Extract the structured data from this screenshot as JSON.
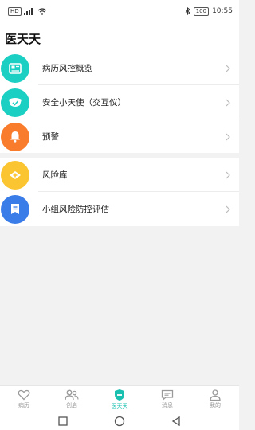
{
  "status_bar": {
    "sim_label": "HD",
    "signal": "4G",
    "battery": "100",
    "time": "10:55"
  },
  "header": {
    "title": "医天天"
  },
  "menu_group_1": [
    {
      "label": "病历风控概览",
      "icon": "medical-record-icon",
      "color": "#1ccfc3"
    },
    {
      "label": "安全小天使（交互仪）",
      "icon": "shield-check-icon",
      "color": "#1ccfc3"
    },
    {
      "label": "预警",
      "icon": "bell-icon",
      "color": "#f97c2c"
    }
  ],
  "menu_group_2": [
    {
      "label": "风险库",
      "icon": "database-icon",
      "color": "#fbc531"
    },
    {
      "label": "小组风险防控评估",
      "icon": "bookmark-icon",
      "color": "#3b7de8"
    }
  ],
  "tabbar": {
    "tabs": [
      {
        "label": "病历",
        "icon": "heart-icon",
        "active": false
      },
      {
        "label": "创启",
        "icon": "users-icon",
        "active": false
      },
      {
        "label": "医天天",
        "icon": "shield-minus-icon",
        "active": true
      },
      {
        "label": "消息",
        "icon": "message-icon",
        "active": false
      },
      {
        "label": "我的",
        "icon": "person-icon",
        "active": false
      }
    ]
  },
  "colors": {
    "accent": "#19c0b0",
    "teal": "#1ccfc3",
    "orange": "#f97c2c",
    "yellow": "#fbc531",
    "blue": "#3b7de8"
  }
}
